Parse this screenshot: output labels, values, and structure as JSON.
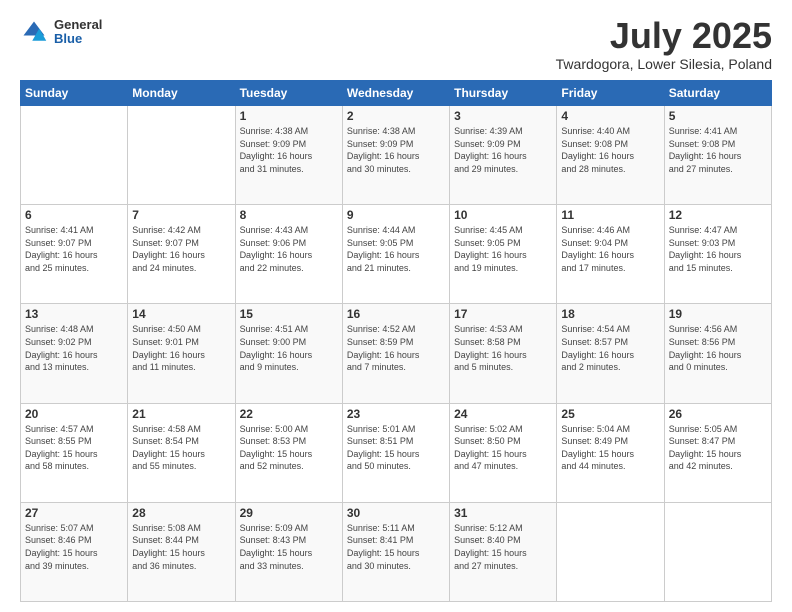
{
  "header": {
    "logo_general": "General",
    "logo_blue": "Blue",
    "month": "July 2025",
    "location": "Twardogora, Lower Silesia, Poland"
  },
  "days_of_week": [
    "Sunday",
    "Monday",
    "Tuesday",
    "Wednesday",
    "Thursday",
    "Friday",
    "Saturday"
  ],
  "weeks": [
    [
      {
        "day": "",
        "detail": ""
      },
      {
        "day": "",
        "detail": ""
      },
      {
        "day": "1",
        "detail": "Sunrise: 4:38 AM\nSunset: 9:09 PM\nDaylight: 16 hours\nand 31 minutes."
      },
      {
        "day": "2",
        "detail": "Sunrise: 4:38 AM\nSunset: 9:09 PM\nDaylight: 16 hours\nand 30 minutes."
      },
      {
        "day": "3",
        "detail": "Sunrise: 4:39 AM\nSunset: 9:09 PM\nDaylight: 16 hours\nand 29 minutes."
      },
      {
        "day": "4",
        "detail": "Sunrise: 4:40 AM\nSunset: 9:08 PM\nDaylight: 16 hours\nand 28 minutes."
      },
      {
        "day": "5",
        "detail": "Sunrise: 4:41 AM\nSunset: 9:08 PM\nDaylight: 16 hours\nand 27 minutes."
      }
    ],
    [
      {
        "day": "6",
        "detail": "Sunrise: 4:41 AM\nSunset: 9:07 PM\nDaylight: 16 hours\nand 25 minutes."
      },
      {
        "day": "7",
        "detail": "Sunrise: 4:42 AM\nSunset: 9:07 PM\nDaylight: 16 hours\nand 24 minutes."
      },
      {
        "day": "8",
        "detail": "Sunrise: 4:43 AM\nSunset: 9:06 PM\nDaylight: 16 hours\nand 22 minutes."
      },
      {
        "day": "9",
        "detail": "Sunrise: 4:44 AM\nSunset: 9:05 PM\nDaylight: 16 hours\nand 21 minutes."
      },
      {
        "day": "10",
        "detail": "Sunrise: 4:45 AM\nSunset: 9:05 PM\nDaylight: 16 hours\nand 19 minutes."
      },
      {
        "day": "11",
        "detail": "Sunrise: 4:46 AM\nSunset: 9:04 PM\nDaylight: 16 hours\nand 17 minutes."
      },
      {
        "day": "12",
        "detail": "Sunrise: 4:47 AM\nSunset: 9:03 PM\nDaylight: 16 hours\nand 15 minutes."
      }
    ],
    [
      {
        "day": "13",
        "detail": "Sunrise: 4:48 AM\nSunset: 9:02 PM\nDaylight: 16 hours\nand 13 minutes."
      },
      {
        "day": "14",
        "detail": "Sunrise: 4:50 AM\nSunset: 9:01 PM\nDaylight: 16 hours\nand 11 minutes."
      },
      {
        "day": "15",
        "detail": "Sunrise: 4:51 AM\nSunset: 9:00 PM\nDaylight: 16 hours\nand 9 minutes."
      },
      {
        "day": "16",
        "detail": "Sunrise: 4:52 AM\nSunset: 8:59 PM\nDaylight: 16 hours\nand 7 minutes."
      },
      {
        "day": "17",
        "detail": "Sunrise: 4:53 AM\nSunset: 8:58 PM\nDaylight: 16 hours\nand 5 minutes."
      },
      {
        "day": "18",
        "detail": "Sunrise: 4:54 AM\nSunset: 8:57 PM\nDaylight: 16 hours\nand 2 minutes."
      },
      {
        "day": "19",
        "detail": "Sunrise: 4:56 AM\nSunset: 8:56 PM\nDaylight: 16 hours\nand 0 minutes."
      }
    ],
    [
      {
        "day": "20",
        "detail": "Sunrise: 4:57 AM\nSunset: 8:55 PM\nDaylight: 15 hours\nand 58 minutes."
      },
      {
        "day": "21",
        "detail": "Sunrise: 4:58 AM\nSunset: 8:54 PM\nDaylight: 15 hours\nand 55 minutes."
      },
      {
        "day": "22",
        "detail": "Sunrise: 5:00 AM\nSunset: 8:53 PM\nDaylight: 15 hours\nand 52 minutes."
      },
      {
        "day": "23",
        "detail": "Sunrise: 5:01 AM\nSunset: 8:51 PM\nDaylight: 15 hours\nand 50 minutes."
      },
      {
        "day": "24",
        "detail": "Sunrise: 5:02 AM\nSunset: 8:50 PM\nDaylight: 15 hours\nand 47 minutes."
      },
      {
        "day": "25",
        "detail": "Sunrise: 5:04 AM\nSunset: 8:49 PM\nDaylight: 15 hours\nand 44 minutes."
      },
      {
        "day": "26",
        "detail": "Sunrise: 5:05 AM\nSunset: 8:47 PM\nDaylight: 15 hours\nand 42 minutes."
      }
    ],
    [
      {
        "day": "27",
        "detail": "Sunrise: 5:07 AM\nSunset: 8:46 PM\nDaylight: 15 hours\nand 39 minutes."
      },
      {
        "day": "28",
        "detail": "Sunrise: 5:08 AM\nSunset: 8:44 PM\nDaylight: 15 hours\nand 36 minutes."
      },
      {
        "day": "29",
        "detail": "Sunrise: 5:09 AM\nSunset: 8:43 PM\nDaylight: 15 hours\nand 33 minutes."
      },
      {
        "day": "30",
        "detail": "Sunrise: 5:11 AM\nSunset: 8:41 PM\nDaylight: 15 hours\nand 30 minutes."
      },
      {
        "day": "31",
        "detail": "Sunrise: 5:12 AM\nSunset: 8:40 PM\nDaylight: 15 hours\nand 27 minutes."
      },
      {
        "day": "",
        "detail": ""
      },
      {
        "day": "",
        "detail": ""
      }
    ]
  ]
}
